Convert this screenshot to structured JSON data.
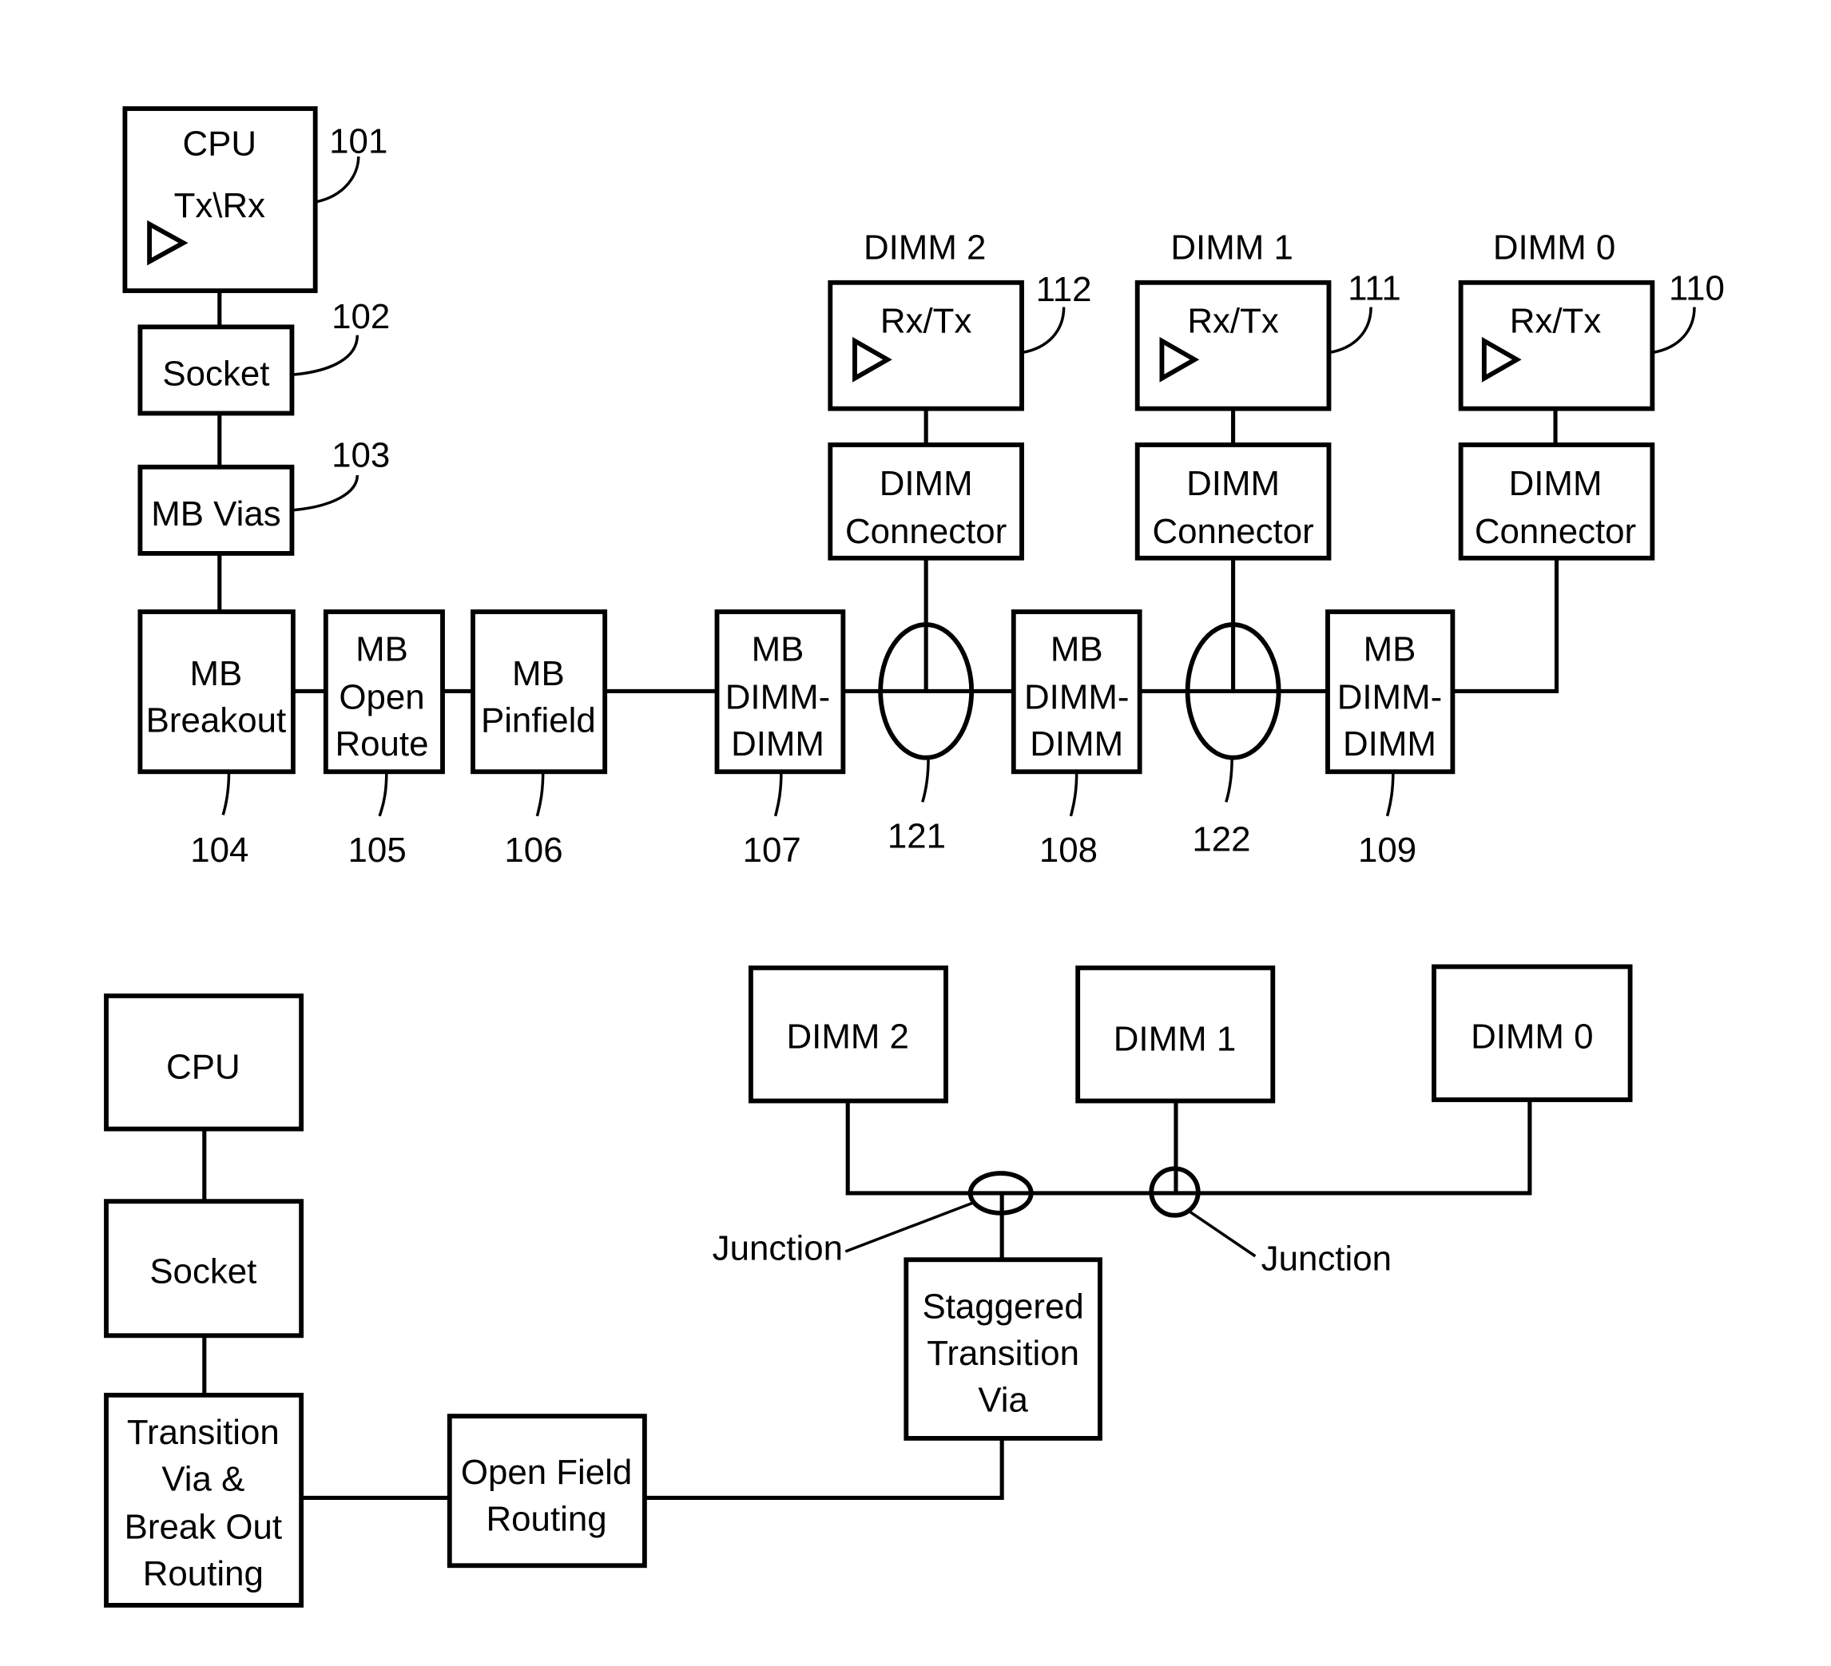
{
  "colors": {
    "stroke": "#000000",
    "background": "#ffffff"
  },
  "top_diagram": {
    "cpu": {
      "title": "CPU",
      "subtitle": "Tx\\Rx",
      "ref": "101"
    },
    "socket": {
      "label": "Socket",
      "ref": "102"
    },
    "mb_vias": {
      "label": "MB Vias",
      "ref": "103"
    },
    "mb_breakout": {
      "lines": [
        "MB",
        "Breakout"
      ],
      "ref": "104"
    },
    "mb_open_route": {
      "lines": [
        "MB",
        "Open",
        "Route"
      ],
      "ref": "105"
    },
    "mb_pinfield": {
      "lines": [
        "MB",
        "Pinfield"
      ],
      "ref": "106"
    },
    "mb_dimm_dimm_a": {
      "lines": [
        "MB",
        "DIMM-",
        "DIMM"
      ],
      "ref": "107"
    },
    "mb_dimm_dimm_b": {
      "lines": [
        "MB",
        "DIMM-",
        "DIMM"
      ],
      "ref": "108"
    },
    "mb_dimm_dimm_c": {
      "lines": [
        "MB",
        "DIMM-",
        "DIMM"
      ],
      "ref": "109"
    },
    "junction_a": {
      "ref": "121"
    },
    "junction_b": {
      "ref": "122"
    },
    "dimms": [
      {
        "title": "DIMM 2",
        "rxtx": "Rx/Tx",
        "ref": "112",
        "connector": [
          "DIMM",
          "Connector"
        ]
      },
      {
        "title": "DIMM 1",
        "rxtx": "Rx/Tx",
        "ref": "111",
        "connector": [
          "DIMM",
          "Connector"
        ]
      },
      {
        "title": "DIMM 0",
        "rxtx": "Rx/Tx",
        "ref": "110",
        "connector": [
          "DIMM",
          "Connector"
        ]
      }
    ]
  },
  "bottom_diagram": {
    "cpu": "CPU",
    "socket": "Socket",
    "transition_via": [
      "Transition",
      "Via &",
      "Break Out",
      "Routing"
    ],
    "open_field": [
      "Open Field",
      "Routing"
    ],
    "staggered": [
      "Staggered",
      "Transition",
      "Via"
    ],
    "dimm2": "DIMM 2",
    "dimm1": "DIMM 1",
    "dimm0": "DIMM 0",
    "junction_left": "Junction",
    "junction_right": "Junction"
  }
}
